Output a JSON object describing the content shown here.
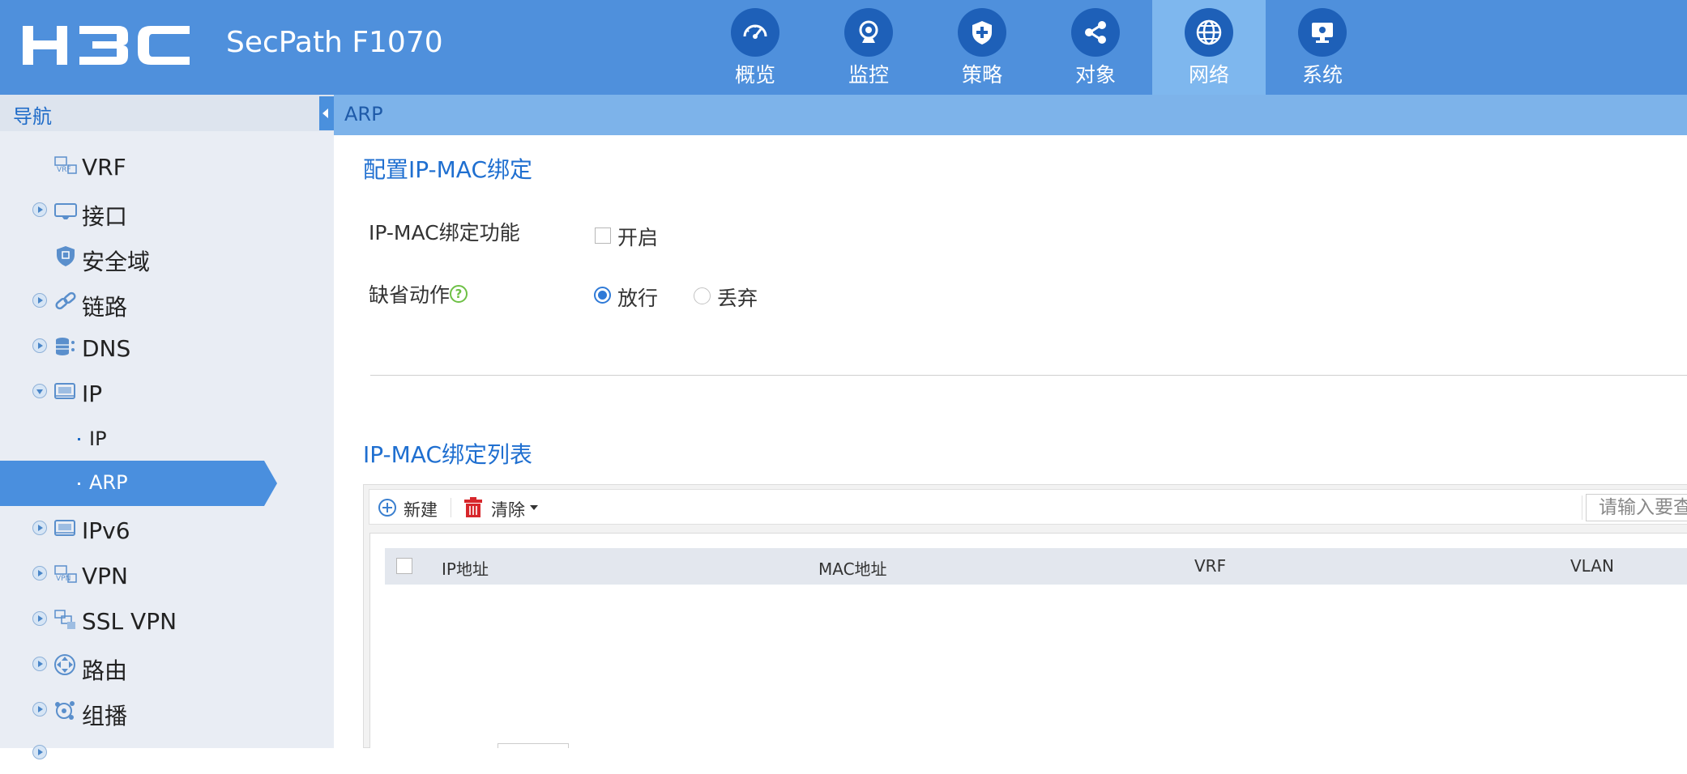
{
  "header": {
    "brand": "H3C",
    "product": "SecPath F1070",
    "tabs": [
      {
        "label": "概览",
        "icon": "dashboard-icon"
      },
      {
        "label": "监控",
        "icon": "camera-icon"
      },
      {
        "label": "策略",
        "icon": "shield-icon"
      },
      {
        "label": "对象",
        "icon": "share-icon"
      },
      {
        "label": "网络",
        "icon": "globe-icon",
        "active": true
      },
      {
        "label": "系统",
        "icon": "monitor-icon"
      }
    ]
  },
  "sidebar": {
    "title": "导航",
    "items": [
      {
        "label": "VRF",
        "icon": "vrf-icon",
        "expandable": false
      },
      {
        "label": "接口",
        "icon": "interface-icon",
        "expandable": true
      },
      {
        "label": "安全域",
        "icon": "security-zone-icon",
        "expandable": false
      },
      {
        "label": "链路",
        "icon": "link-icon",
        "expandable": true
      },
      {
        "label": "DNS",
        "icon": "dns-icon",
        "expandable": true
      },
      {
        "label": "IP",
        "icon": "ip-icon",
        "expandable": true,
        "expanded": true
      },
      {
        "label": "IP",
        "sub": true
      },
      {
        "label": "ARP",
        "sub": true,
        "selected": true
      },
      {
        "label": "IPv6",
        "icon": "ipv6-icon",
        "expandable": true
      },
      {
        "label": "VPN",
        "icon": "vpn-icon",
        "expandable": true
      },
      {
        "label": "SSL VPN",
        "icon": "ssl-vpn-icon",
        "expandable": true
      },
      {
        "label": "路由",
        "icon": "routing-icon",
        "expandable": true
      },
      {
        "label": "组播",
        "icon": "multicast-icon",
        "expandable": true
      }
    ]
  },
  "breadcrumb": "ARP",
  "config": {
    "title": "配置IP-MAC绑定",
    "function_label": "IP-MAC绑定功能",
    "enable_label": "开启",
    "enable_checked": false,
    "default_action_label": "缺省动作",
    "help_glyph": "?",
    "options": [
      {
        "label": "放行",
        "selected": true
      },
      {
        "label": "丢弃",
        "selected": false
      }
    ]
  },
  "list": {
    "title": "IP-MAC绑定列表",
    "toolbar": {
      "new_label": "新建",
      "clear_label": "清除",
      "search_placeholder": "请输入要查询的内容"
    },
    "columns": [
      "IP地址",
      "MAC地址",
      "VRF",
      "VLAN"
    ],
    "rows": []
  },
  "colors": {
    "header_bg": "#4f90dc",
    "active_tab": "#7eb7ee",
    "icon_circle": "#1e60b8",
    "accent": "#1f6fd0",
    "sidebar_selected": "#4a8fde",
    "delete_red": "#d7262b"
  }
}
